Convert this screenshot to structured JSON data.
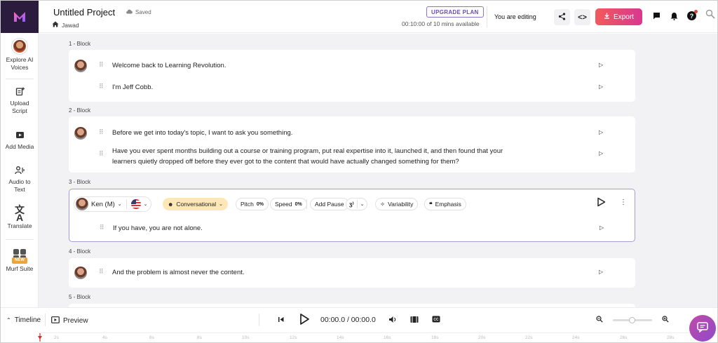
{
  "app": {
    "project_title": "Untitled Project",
    "save_status": "Saved",
    "owner": "Jawad",
    "upgrade_label": "UPGRADE PLAN",
    "minutes": "00:10:00 of 10 mins available",
    "editing_status": "You are editing",
    "export_label": "Export",
    "help_badge": "?"
  },
  "sidebar": {
    "items": [
      {
        "label1": "Explore AI",
        "label2": "Voices",
        "icon": "avatar"
      },
      {
        "label1": "Upload",
        "label2": "Script",
        "icon": "upload-script-icon"
      },
      {
        "label1": "Add Media",
        "label2": "",
        "icon": "add-media-icon"
      },
      {
        "label1": "Audio to",
        "label2": "Text",
        "icon": "audio-to-text-icon"
      },
      {
        "label1": "Translate",
        "label2": "",
        "icon": "translate-icon"
      },
      {
        "label1": "Murf Suite",
        "label2": "",
        "badge": "NEW",
        "icon": "murf-suite-icon"
      }
    ]
  },
  "blocks": [
    {
      "label": "1 -  Block",
      "lines": [
        "Welcome back to Learning Revolution.",
        "I'm Jeff Cobb."
      ]
    },
    {
      "label": "2 -  Block",
      "lines": [
        "Before we get into today's topic, I want to ask you something.",
        "Have you ever spent months building out a course or training program, put real expertise into it, launched it, and then found that your",
        "learners quietly dropped off before they ever got to the content that would have actually changed something for them?"
      ]
    },
    {
      "label": "3 -  Block",
      "voice": "Ken (M)",
      "style": "Conversational",
      "pitch_label": "Pitch",
      "pitch_value": "0%",
      "speed_label": "Speed",
      "speed_value": "0%",
      "pause_label": "Add Pause",
      "variability_label": "Variability",
      "emphasis_label": "Emphasis",
      "lines": [
        "If you have, you are not alone."
      ]
    },
    {
      "label": "4 -  Block",
      "lines": [
        "And the problem is almost never the content."
      ]
    },
    {
      "label": "5 -  Block",
      "lines": []
    }
  ],
  "bottom": {
    "timeline_label": "Timeline",
    "preview_label": "Preview",
    "time": "00:00.0 / 00:00.0",
    "ticks": [
      "2s",
      "4s",
      "6s",
      "8s",
      "10s",
      "12s",
      "14s",
      "16s",
      "18s",
      "20s",
      "22s",
      "24s",
      "26s",
      "28s"
    ]
  }
}
